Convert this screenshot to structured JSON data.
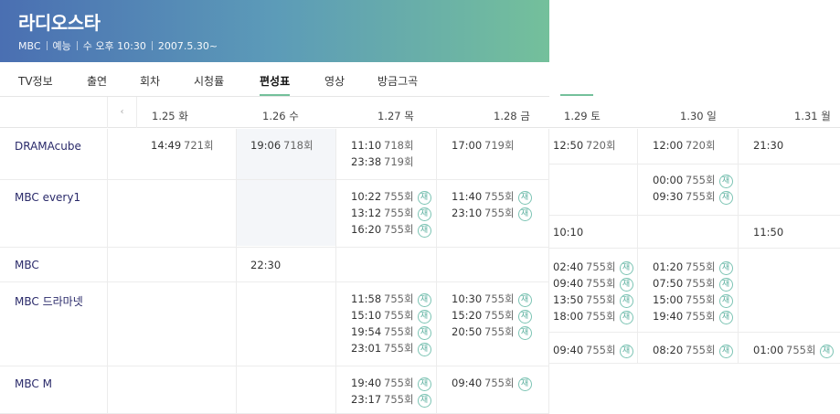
{
  "show": {
    "title": "라디오스타",
    "channel": "MBC",
    "genre": "예능",
    "airtime": "수 오후 10:30",
    "start": "2007.5.30~"
  },
  "tabs": [
    "TV정보",
    "출연",
    "회차",
    "시청률",
    "편성표",
    "영상",
    "방금그곡"
  ],
  "active_tab": "편성표",
  "schedule": {
    "prev_icon": "chevron-left-icon",
    "dates": [
      "1.25 화",
      "1.26 수",
      "1.27 목",
      "1.28 금",
      "1.29 토",
      "1.30 일",
      "1.31 월"
    ],
    "rerun_label": "재",
    "channels": [
      "DRAMAcube",
      "MBC every1",
      "MBC",
      "MBC 드라마넷",
      "MBC M"
    ],
    "cells": {
      "dramacube": {
        "d125": [
          {
            "time": "14:49",
            "ep": "721회"
          }
        ],
        "d126": [
          {
            "time": "19:06",
            "ep": "718회"
          }
        ],
        "d127": [
          {
            "time": "11:10",
            "ep": "718회"
          },
          {
            "time": "23:38",
            "ep": "719회"
          }
        ],
        "d128": [
          {
            "time": "17:00",
            "ep": "719회"
          }
        ],
        "d129": [
          {
            "time": "12:50",
            "ep": "720회"
          }
        ],
        "d130": [
          {
            "time": "12:00",
            "ep": "720회"
          }
        ],
        "d131": [
          {
            "time": "21:30"
          }
        ]
      },
      "every1": {
        "d127": [
          {
            "time": "10:22",
            "ep": "755회"
          },
          {
            "time": "13:12",
            "ep": "755회"
          },
          {
            "time": "16:20",
            "ep": "755회"
          }
        ],
        "d128": [
          {
            "time": "11:40",
            "ep": "755회"
          },
          {
            "time": "23:10",
            "ep": "755회"
          }
        ],
        "d130": [
          {
            "time": "00:00",
            "ep": "755회"
          },
          {
            "time": "09:30",
            "ep": "755회"
          }
        ]
      },
      "mbc": {
        "d126": [
          {
            "time": "22:30"
          }
        ],
        "d129": [
          {
            "time": "10:10"
          }
        ],
        "d131": [
          {
            "time": "11:50"
          }
        ]
      },
      "dramanet": {
        "d127": [
          {
            "time": "11:58",
            "ep": "755회"
          },
          {
            "time": "15:10",
            "ep": "755회"
          },
          {
            "time": "19:54",
            "ep": "755회"
          },
          {
            "time": "23:01",
            "ep": "755회"
          }
        ],
        "d128": [
          {
            "time": "10:30",
            "ep": "755회"
          },
          {
            "time": "15:20",
            "ep": "755회"
          },
          {
            "time": "20:50",
            "ep": "755회"
          }
        ],
        "d129": [
          {
            "time": "02:40",
            "ep": "755회"
          },
          {
            "time": "09:40",
            "ep": "755회"
          },
          {
            "time": "13:50",
            "ep": "755회"
          },
          {
            "time": "18:00",
            "ep": "755회"
          }
        ],
        "d130": [
          {
            "time": "01:20",
            "ep": "755회"
          },
          {
            "time": "07:50",
            "ep": "755회"
          },
          {
            "time": "15:00",
            "ep": "755회"
          },
          {
            "time": "19:40",
            "ep": "755회"
          }
        ]
      },
      "mbcm": {
        "d127": [
          {
            "time": "19:40",
            "ep": "755회"
          },
          {
            "time": "23:17",
            "ep": "755회"
          }
        ],
        "d128": [
          {
            "time": "09:40",
            "ep": "755회"
          }
        ],
        "d129": [
          {
            "time": "09:40",
            "ep": "755회"
          }
        ],
        "d130": [
          {
            "time": "08:20",
            "ep": "755회"
          }
        ],
        "d131": [
          {
            "time": "01:00",
            "ep": "755회"
          }
        ]
      }
    }
  },
  "colors": {
    "banner_start": "#4a6fb2",
    "banner_end": "#74c09b",
    "accent": "#74c09b",
    "channel_text": "#2a2a6a",
    "rerun_badge": "#5aaf9e"
  }
}
